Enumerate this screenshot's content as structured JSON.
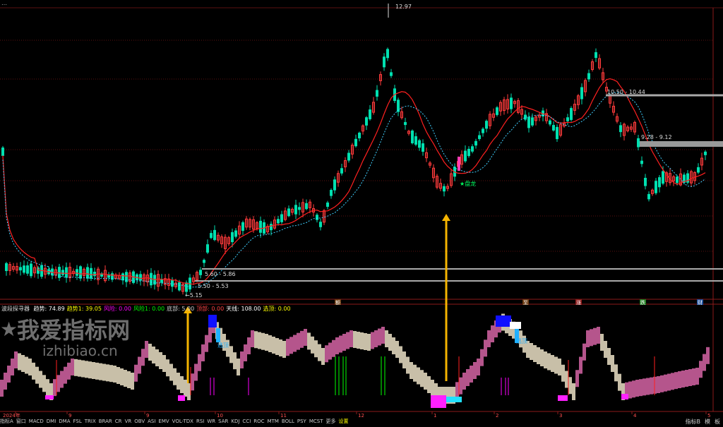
{
  "window": {
    "title": "…"
  },
  "price_chart": {
    "high_label": "12.97",
    "low_label": "5.15",
    "signal_label": "★盘龙",
    "levels": [
      {
        "label": "5.60 - 5.86"
      },
      {
        "label": "5.50 - 5.53"
      },
      {
        "label": "10.50 - 10.44"
      },
      {
        "label": "9.28 - 9.12"
      }
    ],
    "event_badges": [
      "额",
      "至",
      "涨",
      "跌",
      "财"
    ]
  },
  "indicator": {
    "name": "波段探寻器",
    "params": [
      {
        "label": "趋势:",
        "value": "74.89",
        "color": "#ffffff"
      },
      {
        "label": "趋势1:",
        "value": "39.05",
        "color": "#ffff00"
      },
      {
        "label": "风险:",
        "value": "0.00",
        "color": "#ff00ff"
      },
      {
        "label": "风险1:",
        "value": "0.00",
        "color": "#00ff00"
      },
      {
        "label": "底部:",
        "value": "5.00",
        "color": "#cccccc"
      },
      {
        "label": "顶部:",
        "value": "0.00",
        "color": "#ff4444"
      },
      {
        "label": "天线:",
        "value": "108.00",
        "color": "#ffffff"
      },
      {
        "label": "选顶:",
        "value": "0.00",
        "color": "#ffff00"
      }
    ],
    "tag_sell_1": "逃顶",
    "tag_sell_2": "逃顶"
  },
  "watermark": {
    "cn": "我爱指标网",
    "url": "izhibiao.cn"
  },
  "x_axis": {
    "labels": [
      "2024年",
      "9",
      "9",
      "10",
      "11",
      "12",
      "1",
      "2",
      "3",
      "4",
      "5"
    ]
  },
  "bottom_tabs": [
    "指标A",
    "窗口",
    "MACD",
    "DMI",
    "DMA",
    "FSL",
    "TRIX",
    "BRAR",
    "CR",
    "VR",
    "OBV",
    "ASI",
    "EMV",
    "VOL-TDX",
    "RSI",
    "WR",
    "SAR",
    "KDJ",
    "CCI",
    "ROC",
    "MTM",
    "BOLL",
    "PSY",
    "MCST",
    "更多",
    "设置"
  ],
  "bottom_right": [
    "指标B",
    "模",
    "板"
  ],
  "colors": {
    "up": "#ff3b3b",
    "down": "#00e0b0",
    "ma1": "#ff2020",
    "ma2": "#40d0ff",
    "pink": "#b5558c",
    "beige": "#c8bfa8",
    "grid": "#5a1010"
  }
}
